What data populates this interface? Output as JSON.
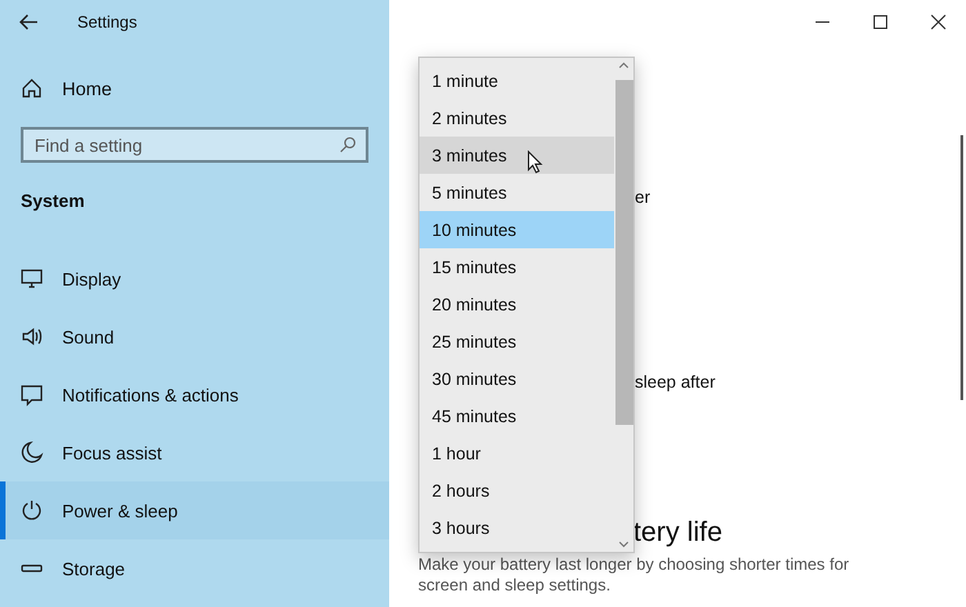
{
  "window": {
    "title": "Settings"
  },
  "sidebar": {
    "home": "Home",
    "search": {
      "placeholder": "Find a setting"
    },
    "section": "System",
    "items": [
      {
        "label": "Display",
        "selected": false
      },
      {
        "label": "Sound",
        "selected": false
      },
      {
        "label": "Notifications & actions",
        "selected": false
      },
      {
        "label": "Focus assist",
        "selected": false
      },
      {
        "label": "Power & sleep",
        "selected": true
      },
      {
        "label": "Storage",
        "selected": false
      }
    ]
  },
  "content": {
    "partial_label_1": "er",
    "partial_label_2": "sleep after",
    "partial_heading": "tery life",
    "description": "Make your battery last longer by choosing shorter times for screen and sleep settings."
  },
  "dropdown": {
    "options": [
      {
        "label": "1 minute",
        "selected": false,
        "hovered": false
      },
      {
        "label": "2 minutes",
        "selected": false,
        "hovered": false
      },
      {
        "label": "3 minutes",
        "selected": false,
        "hovered": true
      },
      {
        "label": "5 minutes",
        "selected": false,
        "hovered": false
      },
      {
        "label": "10 minutes",
        "selected": true,
        "hovered": false
      },
      {
        "label": "15 minutes",
        "selected": false,
        "hovered": false
      },
      {
        "label": "20 minutes",
        "selected": false,
        "hovered": false
      },
      {
        "label": "25 minutes",
        "selected": false,
        "hovered": false
      },
      {
        "label": "30 minutes",
        "selected": false,
        "hovered": false
      },
      {
        "label": "45 minutes",
        "selected": false,
        "hovered": false
      },
      {
        "label": "1 hour",
        "selected": false,
        "hovered": false
      },
      {
        "label": "2 hours",
        "selected": false,
        "hovered": false
      },
      {
        "label": "3 hours",
        "selected": false,
        "hovered": false
      }
    ]
  }
}
